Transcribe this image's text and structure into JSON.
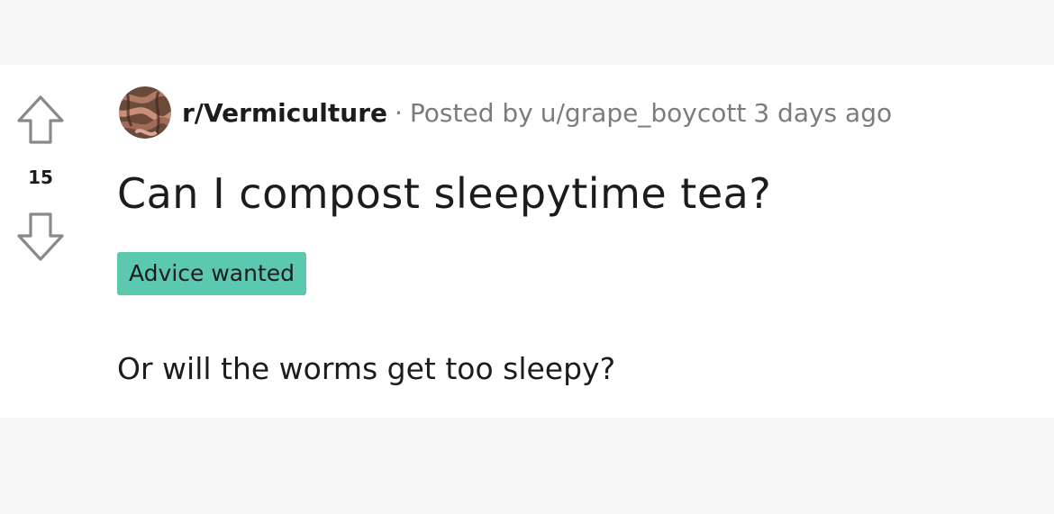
{
  "vote": {
    "score": "15",
    "upvote_icon": "arrow-up-outline-icon",
    "downvote_icon": "arrow-down-outline-icon"
  },
  "post": {
    "subreddit": "r/Vermiculture",
    "separator": "·",
    "posted_by_label": "Posted by",
    "username": "u/grape_boycott",
    "time_ago": "3 days ago",
    "title": "Can I compost sleepytime tea?",
    "flair": "Advice wanted",
    "body": "Or will the worms get too sleepy?"
  },
  "colors": {
    "page_background": "#f6f6f6",
    "card_background": "#ffffff",
    "flair_background": "#5cc8b0",
    "meta_text": "#7c7c7c",
    "primary_text": "#1c1c1c"
  },
  "icons": {
    "subreddit_avatar": "worm-compost-avatar-icon"
  }
}
